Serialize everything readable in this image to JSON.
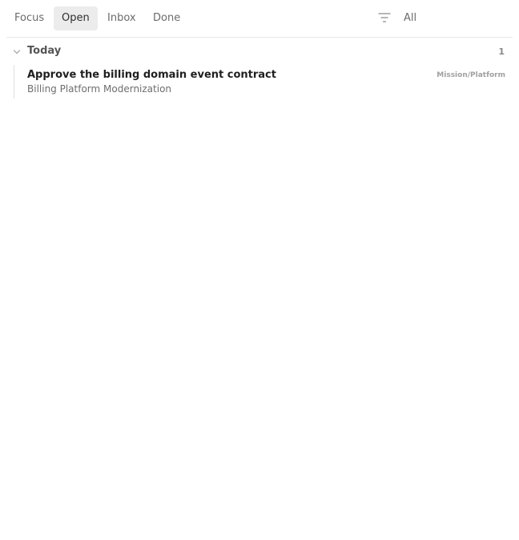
{
  "tabs": [
    {
      "label": "Focus",
      "active": false
    },
    {
      "label": "Open",
      "active": true
    },
    {
      "label": "Inbox",
      "active": false
    },
    {
      "label": "Done",
      "active": false
    }
  ],
  "filter": {
    "icon": "filter-icon",
    "value": "All"
  },
  "section": {
    "title": "Today",
    "count": "1",
    "icon": "chevron-down-icon"
  },
  "tasks": [
    {
      "title": "Approve the billing domain event contract",
      "subtitle": "Billing Platform Modernization",
      "tag": "Mission/Platform"
    }
  ]
}
